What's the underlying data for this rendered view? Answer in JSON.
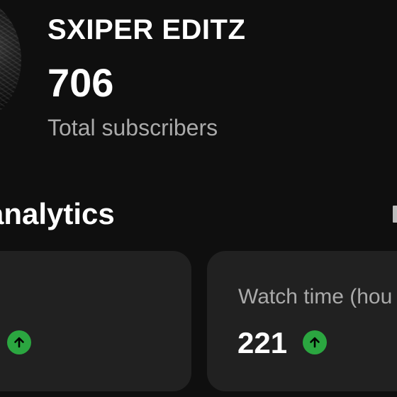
{
  "channel": {
    "name": "SXIPER EDITZ",
    "subscriber_count": "706",
    "subscriber_label": "Total subscribers"
  },
  "analytics": {
    "title": "analytics",
    "cards": [
      {
        "label": "",
        "value": "",
        "trend": "up"
      },
      {
        "label": "Watch time (hou",
        "value": "221",
        "trend": "up"
      }
    ]
  },
  "colors": {
    "background": "#0f0f0f",
    "card_background": "#212121",
    "trend_up": "#2ba640",
    "secondary_text": "#aaaaaa"
  },
  "icons": {
    "trend": "arrow-up-circle-icon",
    "avatar": "channel-avatar"
  }
}
